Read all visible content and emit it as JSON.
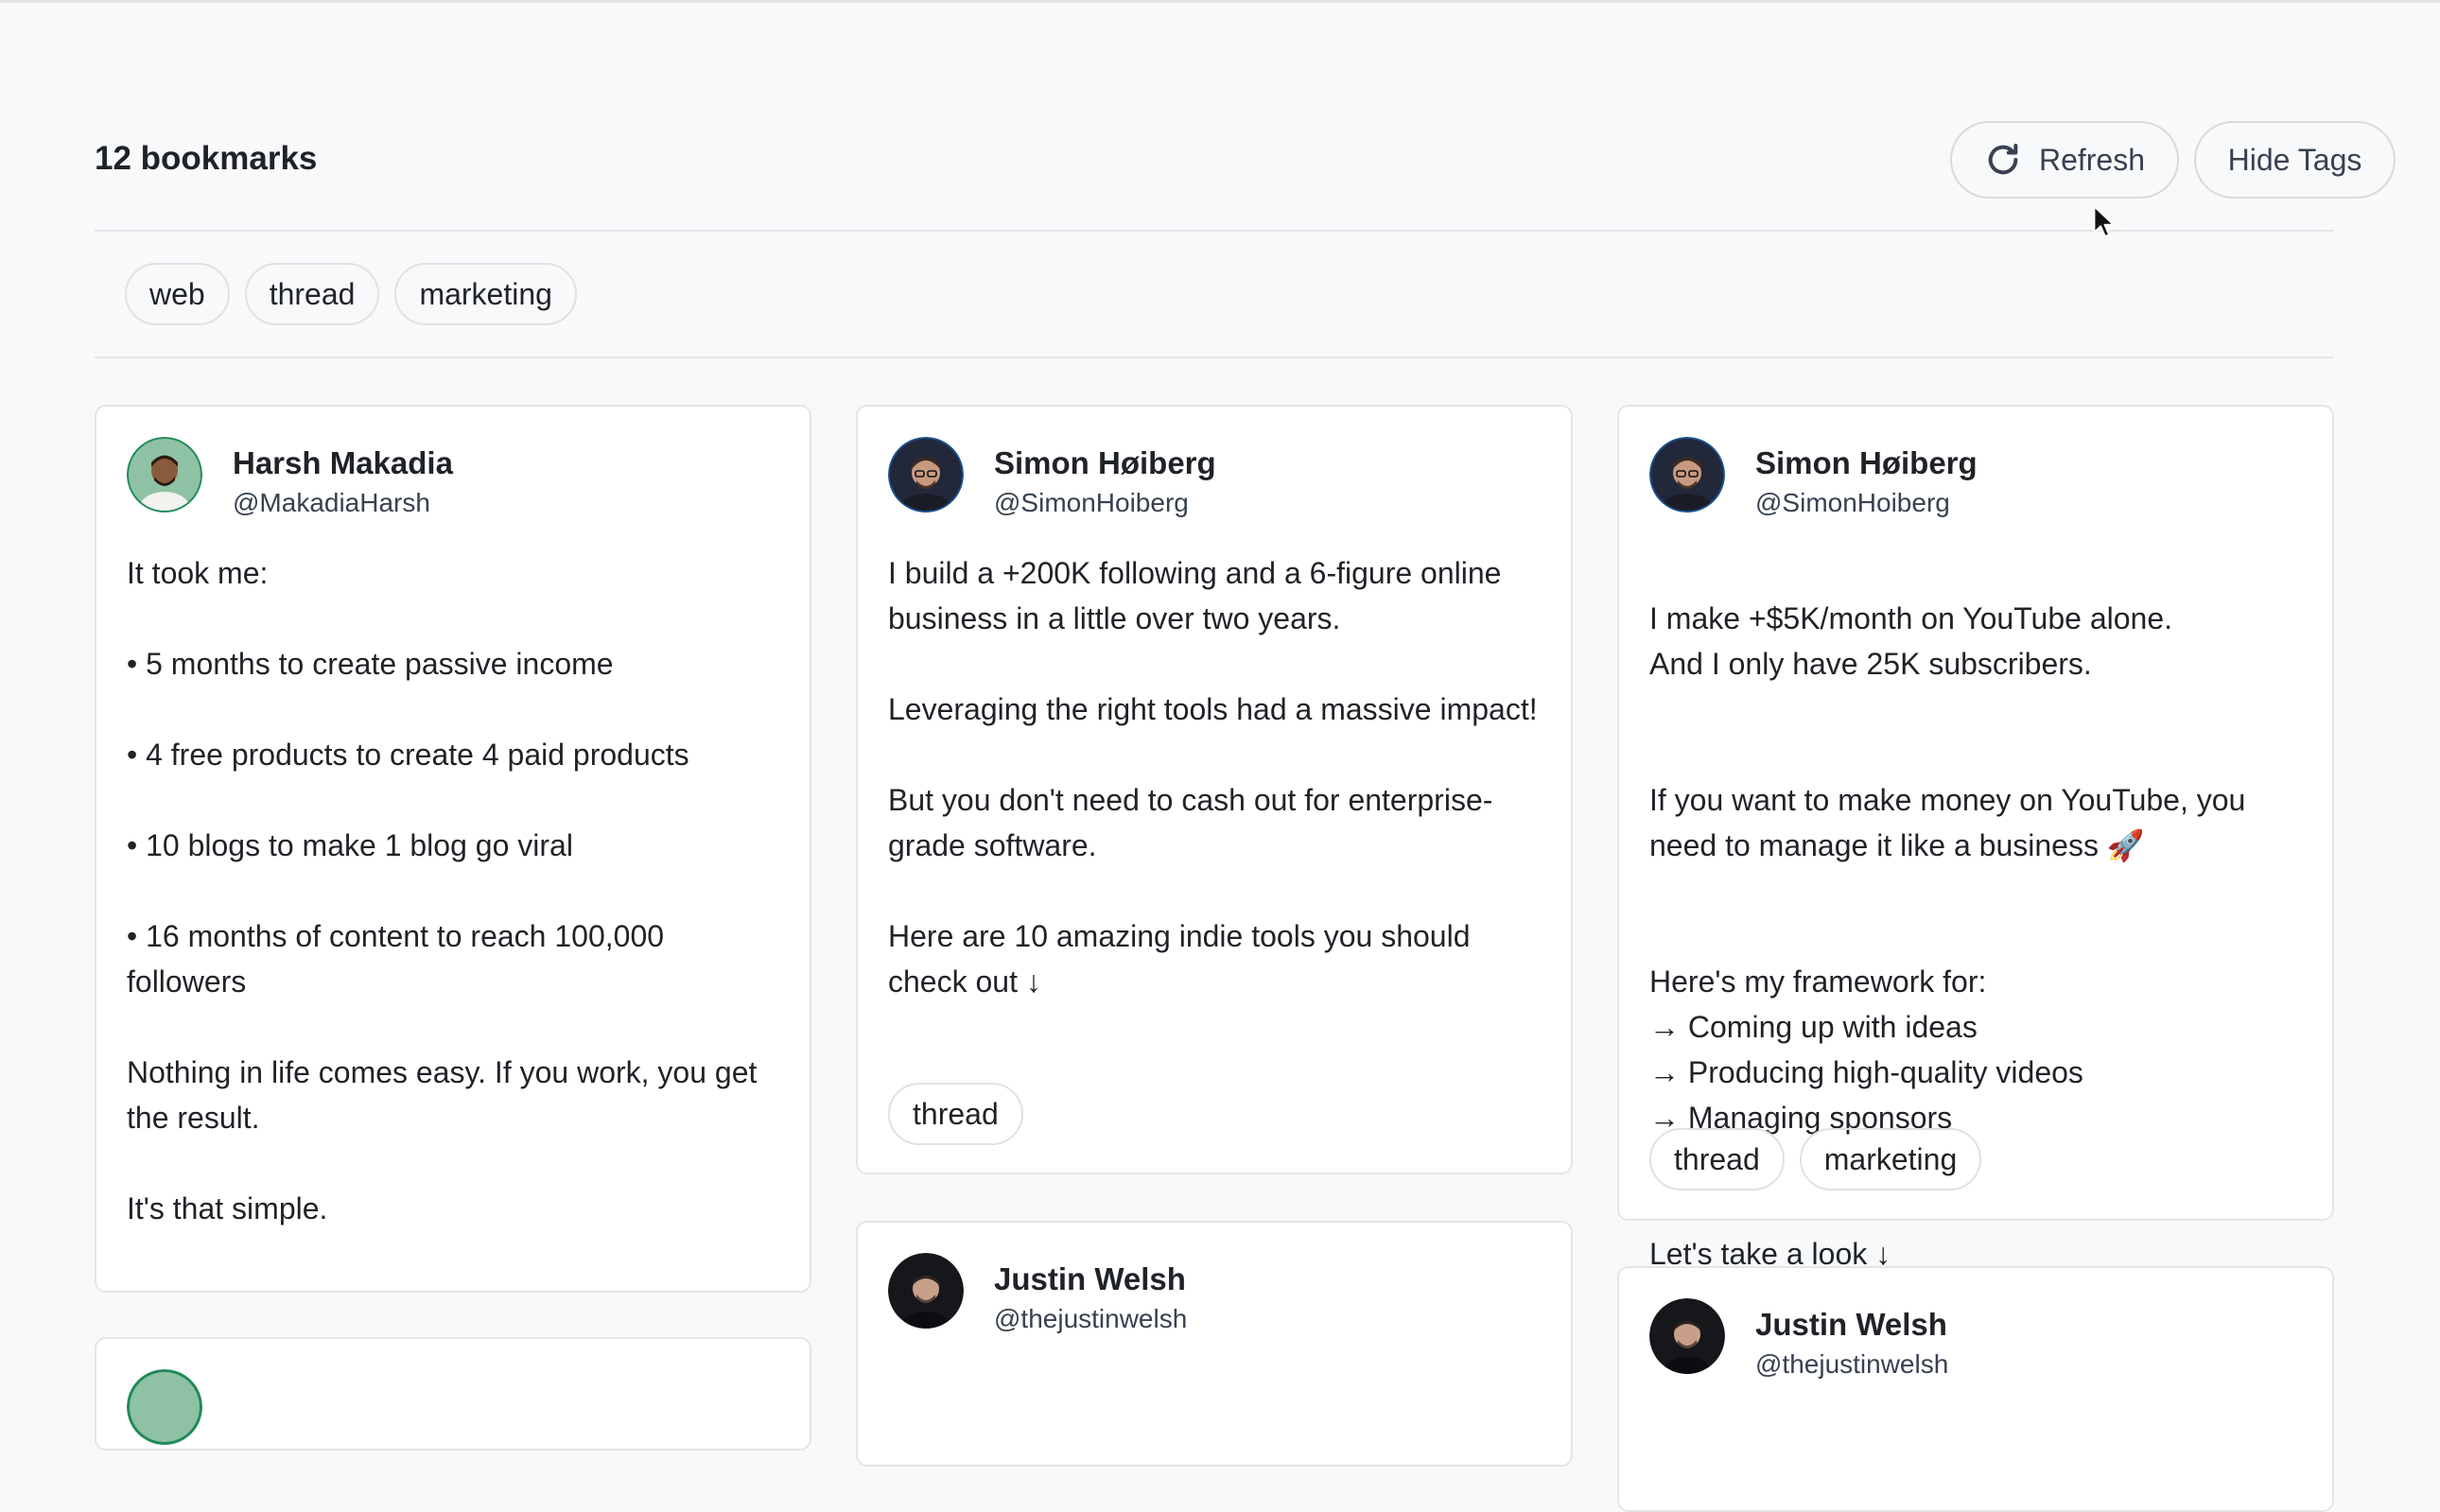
{
  "header": {
    "count_label": "12 bookmarks",
    "refresh_label": "Refresh",
    "hide_tags_label": "Hide Tags"
  },
  "tag_filters": [
    "web",
    "thread",
    "marketing"
  ],
  "cards": [
    {
      "author": "Harsh Makadia",
      "handle": "@MakadiaHarsh",
      "paragraphs": [
        "It took me:",
        "• 5 months to create passive income",
        "• 4 free products to create 4 paid products",
        "• 10 blogs to make 1 blog go viral",
        "• 16 months of content to reach 100,000 followers",
        "Nothing in life comes easy. If you work, you get the result.",
        "It's that simple."
      ],
      "tags": []
    },
    {
      "author": "Simon Høiberg",
      "handle": "@SimonHoiberg",
      "paragraphs": [
        "I build a +200K following and a 6-figure online business in a little over two years.",
        "Leveraging the right tools had a massive impact!",
        "But you don't need to cash out for enterprise-grade software.",
        "Here are 10 amazing indie tools you should check out ↓"
      ],
      "tags": [
        "thread"
      ]
    },
    {
      "author": "Simon Høiberg",
      "handle": "@SimonHoiberg",
      "paragraphs": [
        "I make +$5K/month on YouTube alone.\nAnd I only have 25K subscribers.",
        "If you want to make money on YouTube, you need to manage it like a business 🚀",
        "Here's my framework for:\n→ Coming up with ideas\n→ Producing high-quality videos\n→ Managing sponsors",
        "Let's take a look ↓"
      ],
      "tags": [
        "thread",
        "marketing"
      ]
    },
    {
      "author": "Justin Welsh",
      "handle": "@thejustinwelsh",
      "paragraphs": [],
      "tags": []
    },
    {
      "author": "Justin Welsh",
      "handle": "@thejustinwelsh",
      "paragraphs": [],
      "tags": []
    }
  ],
  "icons": {
    "refresh": "refresh-icon",
    "cursor": "mouse-pointer-icon"
  },
  "colors": {
    "background": "#f8f9fa",
    "card": "#ffffff",
    "border": "#e3e5e8",
    "text": "#1f2328"
  }
}
